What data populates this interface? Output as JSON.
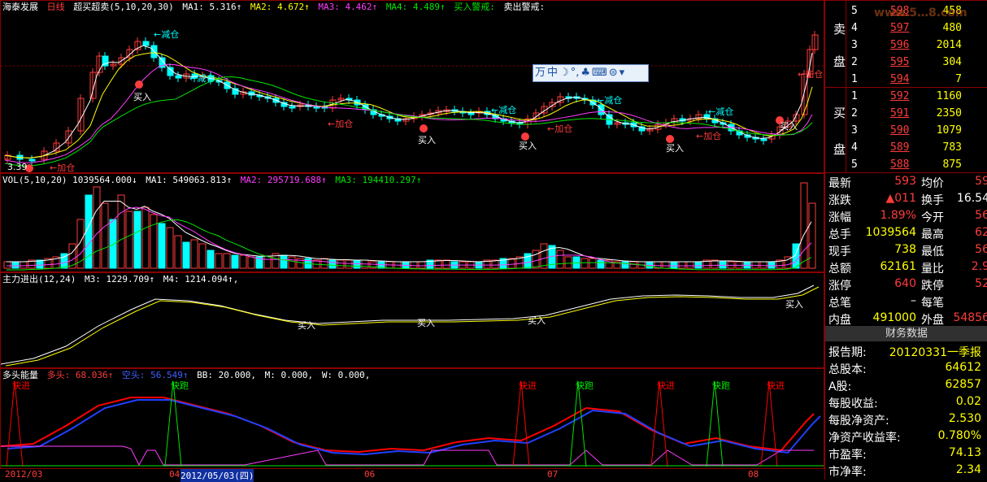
{
  "main_header": {
    "stock_name": "海泰发展",
    "period": "日线",
    "indicator": "超买超卖(5,10,20,30)",
    "ma1": "MA1: 5.316↑",
    "ma2": "MA2: 4.672↑",
    "ma3": "MA3: 4.462↑",
    "ma4": "MA4: 4.489↑",
    "buy_warn": "买入警戒:",
    "sell_warn": "卖出警戒:"
  },
  "vol_header": {
    "vol": "VOL(5,10,20) 1039564.000↓",
    "ma1": "MA1: 549063.813↑",
    "ma2": "MA2: 295719.688↑",
    "ma3": "MA3: 194410.297↑"
  },
  "zl_header": {
    "name": "主力进出(12,24)",
    "m3": "M3: 1229.709↑",
    "m4": "M4: 1214.094↑,"
  },
  "dt_header": {
    "name": "多头能量",
    "duotou": "多头: 68.036↑",
    "kongtou": "空头: 56.549↑",
    "bb": "BB: 20.000,",
    "m": "M: 0.000,",
    "w": "W: 0.000,"
  },
  "annotations": {
    "jiancang": "减仓",
    "jiacang": "加仓",
    "mairu": "买入",
    "kuaijin": "快进",
    "kuaipao": "快跑",
    "low_price": "3.39"
  },
  "toolbar": {
    "items": [
      "万",
      "中",
      "☽",
      "°,",
      "♣",
      "⌨",
      "⊜",
      "▾"
    ]
  },
  "date_axis": {
    "labels": [
      {
        "text": "2012/03"
      },
      {
        "text": "04"
      },
      {
        "text": "2012/05/03(四)"
      },
      {
        "text": "06"
      },
      {
        "text": "07"
      },
      {
        "text": "08"
      }
    ]
  },
  "order_book": {
    "sell_label": [
      "卖",
      "盘"
    ],
    "buy_label": [
      "买",
      "盘"
    ],
    "sells": [
      {
        "level": "5",
        "price": "598",
        "vol": "458"
      },
      {
        "level": "4",
        "price": "597",
        "vol": "480"
      },
      {
        "level": "3",
        "price": "596",
        "vol": "2014"
      },
      {
        "level": "2",
        "price": "595",
        "vol": "304"
      },
      {
        "level": "1",
        "price": "594",
        "vol": "7"
      }
    ],
    "buys": [
      {
        "level": "1",
        "price": "592",
        "vol": "1160"
      },
      {
        "level": "2",
        "price": "591",
        "vol": "2350"
      },
      {
        "level": "3",
        "price": "590",
        "vol": "1079"
      },
      {
        "level": "4",
        "price": "589",
        "vol": "783"
      },
      {
        "level": "5",
        "price": "588",
        "vol": "875"
      }
    ],
    "watermark": "www.5…8.com"
  },
  "quote": {
    "rows": [
      {
        "l1": "最新",
        "v1": "593",
        "l2": "均价",
        "v2": "59"
      },
      {
        "l1": "涨跌",
        "v1": "▲011",
        "l2": "换手",
        "v2": "16.54"
      },
      {
        "l1": "涨幅",
        "v1": "1.89%",
        "l2": "今开",
        "v2": "56"
      },
      {
        "l1": "总手",
        "v1": "1039564",
        "l2": "最高",
        "v2": "62"
      },
      {
        "l1": "现手",
        "v1": "738",
        "l2": "最低",
        "v2": "56"
      },
      {
        "l1": "总额",
        "v1": "62161",
        "l2": "量比",
        "v2": "2.9"
      },
      {
        "l1": "涨停",
        "v1": "640",
        "l2": "跌停",
        "v2": "52"
      },
      {
        "l1": "总笔",
        "v1": "–",
        "l2": "每笔",
        "v2": ""
      },
      {
        "l1": "内盘",
        "v1": "491000",
        "l2": "外盘",
        "v2": "54856"
      }
    ]
  },
  "finance": {
    "title": "财务数据",
    "rows": [
      {
        "label": "报告期:",
        "value": "20120331一季报"
      },
      {
        "label": "总股本:",
        "value": "64612"
      },
      {
        "label": "A股:",
        "value": "62857"
      },
      {
        "label": "每股收益:",
        "value": "0.02"
      },
      {
        "label": "每股净资产:",
        "value": "2.530"
      },
      {
        "label": "净资产收益率:",
        "value": "0.780%"
      },
      {
        "label": "市盈率:",
        "value": "74.13"
      },
      {
        "label": "市净率:",
        "value": "2.34"
      }
    ]
  },
  "colors": {
    "up": "#ff3c3c",
    "down": "#00ffff",
    "ma1": "#ffffff",
    "ma2": "#ffff00",
    "ma3": "#ff3cff",
    "ma4": "#00e600",
    "dt_red": "#ff0000",
    "dt_blue": "#2040ff"
  }
}
